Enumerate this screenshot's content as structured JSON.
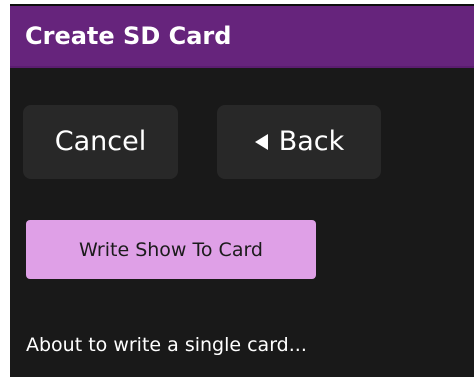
{
  "header": {
    "title": "Create SD Card"
  },
  "nav": {
    "cancel_label": "Cancel",
    "back_label": "Back",
    "back_icon": "chevron-left-icon"
  },
  "actions": {
    "write_label": "Write Show To Card"
  },
  "status": {
    "message": "About to write a single card..."
  },
  "colors": {
    "titlebar": "#66247c",
    "background": "#191919",
    "nav_button": "#282828",
    "write_button": "#dfa0e7",
    "text": "#ffffff"
  }
}
